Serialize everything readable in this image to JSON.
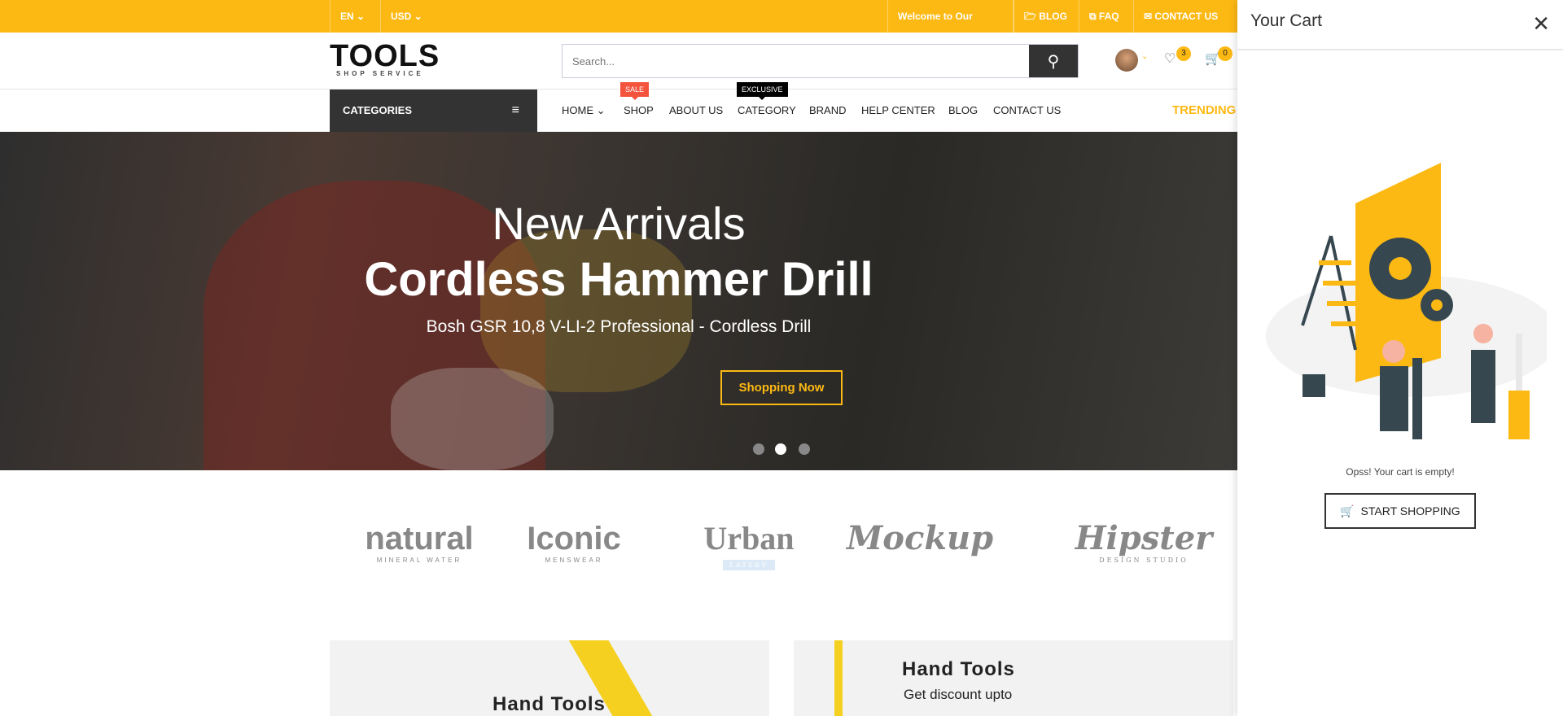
{
  "topbar": {
    "language": "EN",
    "currency": "USD",
    "welcome": "Welcome to Our Store!",
    "blog": "BLOG",
    "faq": "FAQ",
    "contact": "CONTACT US"
  },
  "header": {
    "logo": "TOOLS",
    "logo_sub": "SHOP SERVICE",
    "search_placeholder": "Search...",
    "wishlist_count": "3",
    "cart_count": "0"
  },
  "nav": {
    "categories": "CATEGORIES",
    "items": [
      {
        "label": "HOME ⌄"
      },
      {
        "label": "SHOP",
        "tag": "SALE"
      },
      {
        "label": "ABOUT US"
      },
      {
        "label": "CATEGORY",
        "tag": "EXCLUSIVE"
      },
      {
        "label": "BRAND"
      },
      {
        "label": "HELP CENTER"
      },
      {
        "label": "BLOG"
      },
      {
        "label": "CONTACT US"
      }
    ],
    "trending": "TRENDING"
  },
  "hero": {
    "line1": "New Arrivals",
    "line2": "Cordless Hammer Drill",
    "line3": "Bosh GSR 10,8 V-LI-2 Professional - Cordless Drill",
    "button": "Shopping Now",
    "active_slide": 2,
    "slides": 3
  },
  "brands": [
    {
      "name": "natural",
      "sub": "MINERAL WATER"
    },
    {
      "name": "Iconic",
      "sub": "MENSWEAR"
    },
    {
      "name": "Urban",
      "sub": "EATERY"
    },
    {
      "name": "Mockup",
      "sub": ""
    },
    {
      "name": "Hipster",
      "sub": "DESIGN STUDIO"
    }
  ],
  "banners": [
    {
      "title": "Hand Tools"
    },
    {
      "title": "Hand Tools",
      "subtitle": "Get discount upto"
    }
  ],
  "cart": {
    "title": "Your Cart",
    "empty_message": "Opss! Your cart is empty!",
    "button": "START SHOPPING"
  },
  "colors": {
    "accent": "#fdb913",
    "dark": "#333333",
    "sale": "#f4533c"
  }
}
